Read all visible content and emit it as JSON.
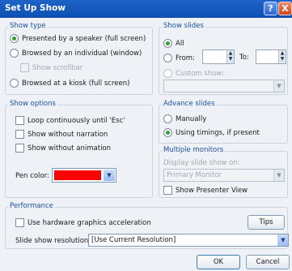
{
  "window": {
    "title": "Set Up Show",
    "help_glyph": "?",
    "close_glyph": "X"
  },
  "show_type": {
    "label": "Show type",
    "presented": "Presented by a speaker (full screen)",
    "browsed_individual": "Browsed by an individual (window)",
    "show_scrollbar": "Show scrollbar",
    "browsed_kiosk": "Browsed at a kiosk (full screen)"
  },
  "show_slides": {
    "label": "Show slides",
    "all": "All",
    "from": "From:",
    "to": "To:",
    "custom_show": "Custom show:"
  },
  "show_options": {
    "label": "Show options",
    "loop": "Loop continuously until 'Esc'",
    "without_narration": "Show without narration",
    "without_animation": "Show without animation",
    "pen_color": "Pen color:",
    "pen_color_value": "#ff0000"
  },
  "advance_slides": {
    "label": "Advance slides",
    "manually": "Manually",
    "using_timings": "Using timings, if present"
  },
  "multiple_monitors": {
    "label": "Multiple monitors",
    "display_on": "Display slide show on:",
    "monitor_value": "Primary Monitor",
    "presenter_view": "Show Presenter View"
  },
  "performance": {
    "label": "Performance",
    "hardware_accel": "Use hardware graphics acceleration",
    "tips": "Tips",
    "resolution_label": "Slide show resolution:",
    "resolution_value": "[Use Current Resolution]"
  },
  "buttons": {
    "ok": "OK",
    "cancel": "Cancel"
  },
  "icons": {
    "dropdown": "▼",
    "spin_up": "▲",
    "spin_down": "▼"
  }
}
